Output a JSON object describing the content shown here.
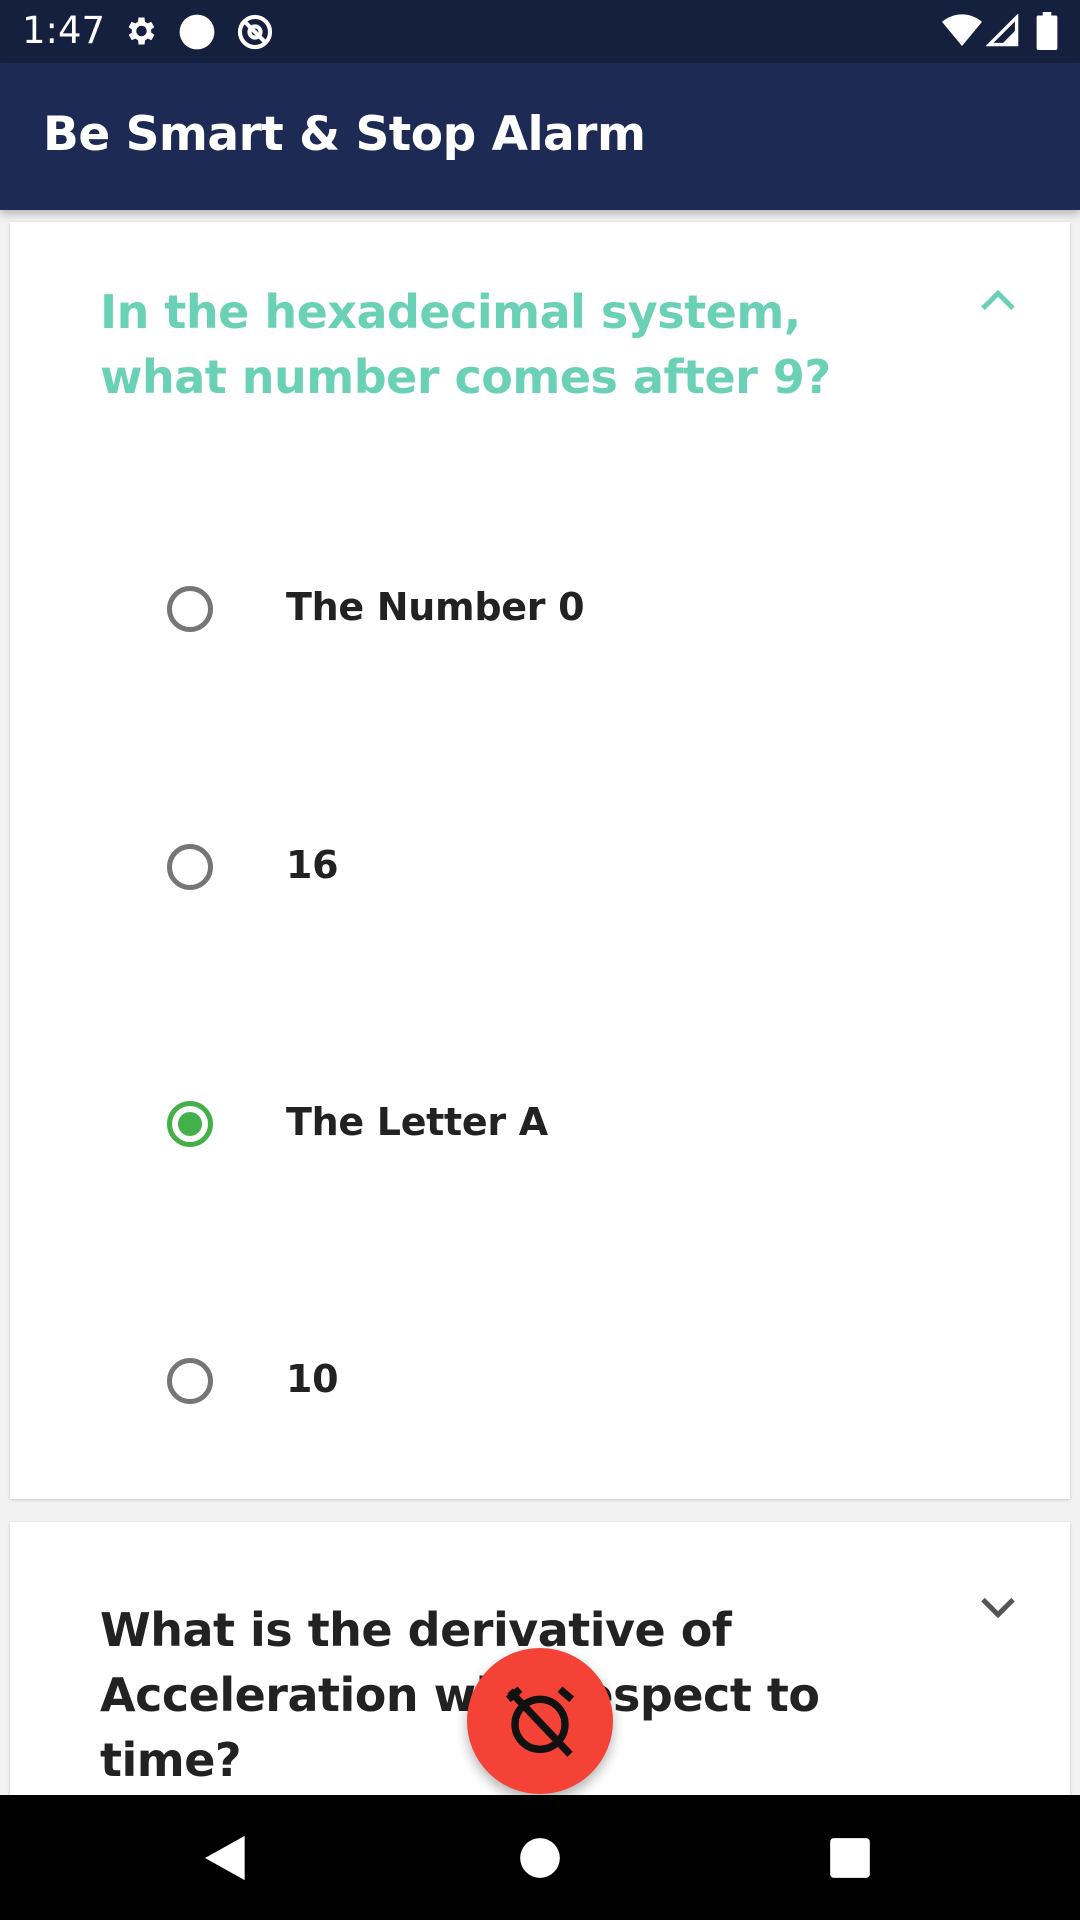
{
  "status_bar": {
    "time": "1:47",
    "left_icons": [
      "gear-icon",
      "circle-icon",
      "at-sign-icon"
    ],
    "right_icons": [
      "wifi-icon",
      "signal-icon",
      "battery-icon"
    ]
  },
  "app_bar": {
    "title": "Be Smart & Stop Alarm",
    "background": "#1c2a54"
  },
  "questions": [
    {
      "text": "In the hexadecimal system, what number comes after 9?",
      "expanded": true,
      "color": "#6bd1b6",
      "options": [
        {
          "label": "The Number 0",
          "selected": false
        },
        {
          "label": "16",
          "selected": false
        },
        {
          "label": "The Letter A",
          "selected": true
        },
        {
          "label": "10",
          "selected": false
        }
      ]
    },
    {
      "text": "What is the derivative of Acceleration with respect to time?",
      "expanded": false,
      "color": "#222222"
    }
  ],
  "fab": {
    "icon": "alarm-off-icon",
    "color": "#f44336"
  },
  "nav_bar": {
    "buttons": [
      "back-icon",
      "home-icon",
      "recents-icon"
    ]
  },
  "colors": {
    "accent": "#6bd1b6",
    "selected_radio": "#43b04a",
    "unselected_radio": "#767676"
  }
}
